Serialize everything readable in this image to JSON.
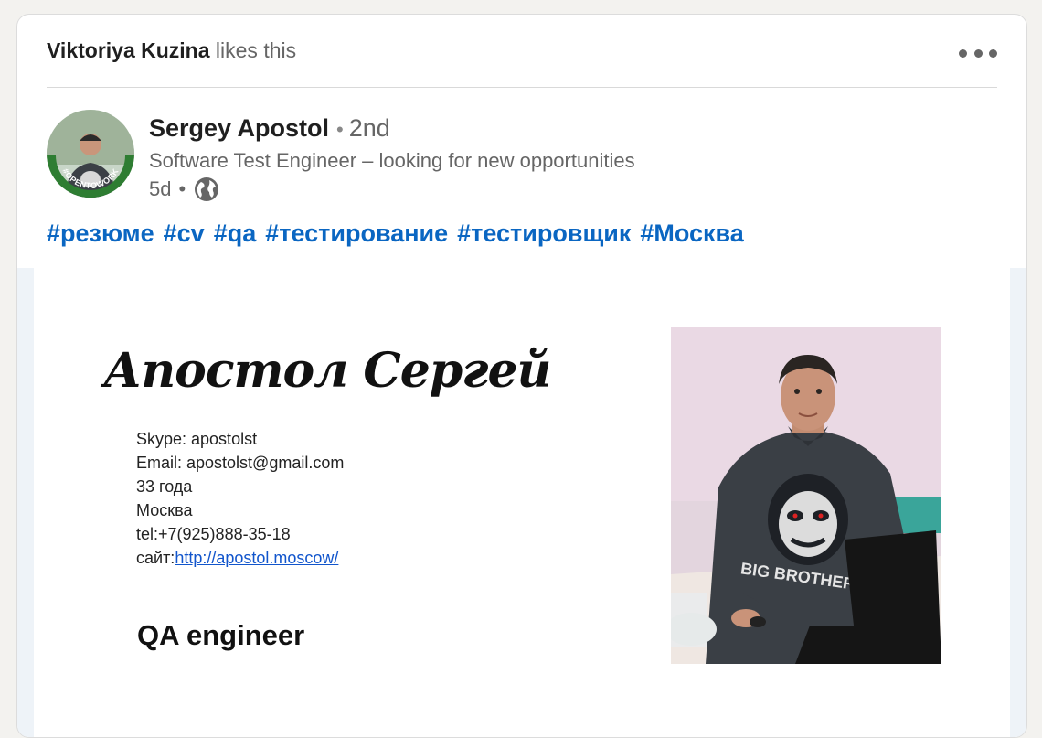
{
  "social": {
    "actor": "Viktoriya Kuzina",
    "action": "likes this"
  },
  "author": {
    "name": "Sergey Apostol",
    "degree": "2nd",
    "headline": "Software Test Engineer – looking for new opportunities",
    "time": "5d",
    "badge": "#OPENTOWORK"
  },
  "hashtags": [
    "#резюме",
    "#cv",
    "#qa",
    "#тестирование",
    "#тестировщик",
    "#Москва"
  ],
  "resume": {
    "name": "Апостол Сергей",
    "skype": "Skype: apostolst",
    "email": "Email: apostolst@gmail.com",
    "age": "33 года",
    "city": "Москва",
    "tel": "tel:+7(925)888-35-18",
    "site_label": "сайт:",
    "site_url": "http://apostol.moscow/",
    "role": "QA engineer",
    "shirt_text": "BIG BROTHER"
  },
  "colors": {
    "link": "#0a66c2",
    "avatar_ring": "#2e7d32"
  },
  "icons": {
    "more": "more-horizontal-icon",
    "visibility": "globe-icon"
  }
}
